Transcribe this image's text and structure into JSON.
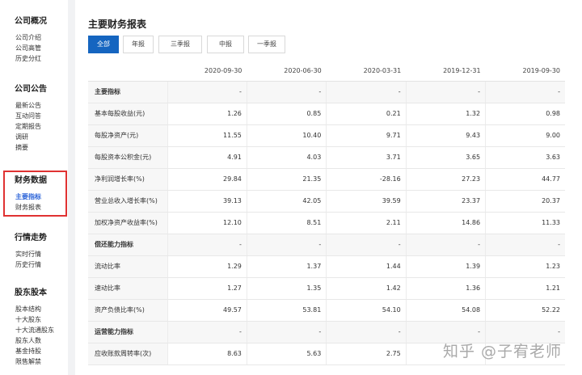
{
  "sidebar": {
    "sections": [
      {
        "title": "公司概况",
        "items": [
          "公司介绍",
          "公司高管",
          "历史分红"
        ]
      },
      {
        "title": "公司公告",
        "items": [
          "最新公告",
          "互动问答",
          "定期报告",
          "调研",
          "摘要"
        ]
      },
      {
        "title": "财务数据",
        "items": [
          "主要指标",
          "财务报表"
        ],
        "active_item": 0
      },
      {
        "title": "行情走势",
        "items": [
          "实时行情",
          "历史行情"
        ]
      },
      {
        "title": "股东股本",
        "items": [
          "股本结构",
          "十大股东",
          "十大流通股东",
          "股东人数",
          "基金持股",
          "限售解禁"
        ]
      }
    ]
  },
  "main": {
    "title": "主要财务报表",
    "tabs": [
      "全部",
      "年报",
      "三季报",
      "中报",
      "一季报"
    ],
    "active_tab": 0,
    "table": {
      "columns": [
        "",
        "2020-09-30",
        "2020-06-30",
        "2020-03-31",
        "2019-12-31",
        "2019-09-30"
      ],
      "rows": [
        {
          "label": "主要指标",
          "section": true,
          "values": [
            "-",
            "-",
            "-",
            "-",
            "-"
          ]
        },
        {
          "label": "基本每股收益(元)",
          "values": [
            "1.26",
            "0.85",
            "0.21",
            "1.32",
            "0.98"
          ]
        },
        {
          "label": "每股净资产(元)",
          "values": [
            "11.55",
            "10.40",
            "9.71",
            "9.43",
            "9.00"
          ]
        },
        {
          "label": "每股资本公积金(元)",
          "values": [
            "4.91",
            "4.03",
            "3.71",
            "3.65",
            "3.63"
          ]
        },
        {
          "label": "净利润增长率(%)",
          "values": [
            "29.84",
            "21.35",
            "-28.16",
            "27.23",
            "44.77"
          ]
        },
        {
          "label": "营业总收入增长率(%)",
          "values": [
            "39.13",
            "42.05",
            "39.59",
            "23.37",
            "20.37"
          ]
        },
        {
          "label": "加权净资产收益率(%)",
          "values": [
            "12.10",
            "8.51",
            "2.11",
            "14.86",
            "11.33"
          ]
        },
        {
          "label": "偿还能力指标",
          "section": true,
          "values": [
            "-",
            "-",
            "-",
            "-",
            "-"
          ]
        },
        {
          "label": "流动比率",
          "values": [
            "1.29",
            "1.37",
            "1.44",
            "1.39",
            "1.23"
          ]
        },
        {
          "label": "速动比率",
          "values": [
            "1.27",
            "1.35",
            "1.42",
            "1.36",
            "1.21"
          ]
        },
        {
          "label": "资产负债比率(%)",
          "values": [
            "49.57",
            "53.81",
            "54.10",
            "54.08",
            "52.22"
          ]
        },
        {
          "label": "运营能力指标",
          "section": true,
          "values": [
            "-",
            "-",
            "-",
            "-",
            "-"
          ]
        },
        {
          "label": "应收账款周转率(次)",
          "values": [
            "8.63",
            "5.63",
            "2.75",
            "",
            ""
          ]
        }
      ]
    }
  },
  "watermark": "知乎 @子宥老师"
}
